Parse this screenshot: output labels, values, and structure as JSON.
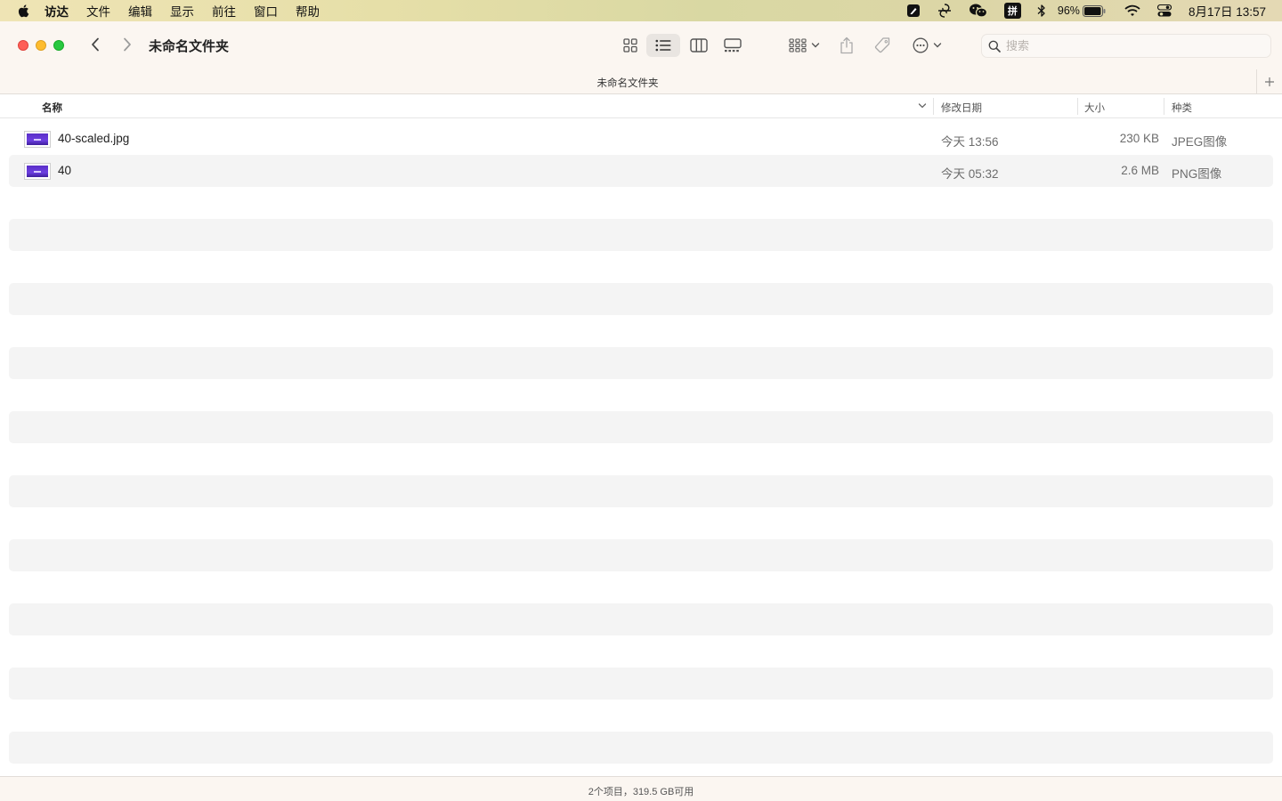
{
  "menubar": {
    "items": [
      "访达",
      "文件",
      "编辑",
      "显示",
      "前往",
      "窗口",
      "帮助"
    ],
    "battery_percent": "96%",
    "input_method": "拼",
    "clock": "8月17日 13:57"
  },
  "window": {
    "title": "未命名文件夹",
    "tab_title": "未命名文件夹",
    "search_placeholder": "搜索"
  },
  "columns": {
    "name": "名称",
    "date": "修改日期",
    "size": "大小",
    "kind": "种类"
  },
  "files": [
    {
      "name": "40-scaled.jpg",
      "date": "今天 13:56",
      "size": "230 KB",
      "kind": "JPEG图像"
    },
    {
      "name": "40",
      "date": "今天 05:32",
      "size": "2.6 MB",
      "kind": "PNG图像"
    }
  ],
  "status": "2个项目，319.5 GB可用",
  "colors": {
    "close": "#fe5f57",
    "minimize": "#febc2e",
    "maximize": "#28c840",
    "stripe": "#f4f4f4"
  }
}
